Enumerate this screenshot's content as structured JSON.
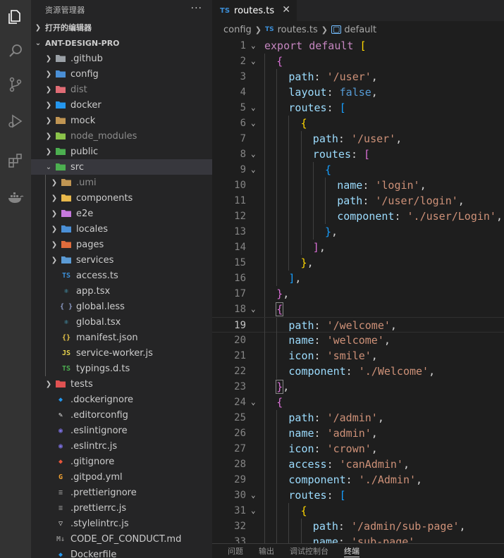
{
  "activity_bar": [
    {
      "name": "explorer-icon",
      "active": true
    },
    {
      "name": "search-icon",
      "active": false
    },
    {
      "name": "source-control-icon",
      "active": false
    },
    {
      "name": "run-debug-icon",
      "active": false
    },
    {
      "name": "extensions-icon",
      "active": false
    },
    {
      "name": "docker-icon",
      "active": false
    }
  ],
  "sidebar": {
    "title": "资源管理器",
    "more": "···",
    "open_editors": "打开的编辑器",
    "project": "ANT-DESIGN-PRO",
    "items": [
      {
        "label": ".github",
        "kind": "folder",
        "depth": 0,
        "icon": "github-folder-icon",
        "color": "#9aa0a6",
        "glyph": "◉"
      },
      {
        "label": "config",
        "kind": "folder",
        "depth": 0,
        "icon": "config-folder-icon",
        "color": "#4a8fd6",
        "glyph": "⚙"
      },
      {
        "label": "dist",
        "kind": "folder",
        "depth": 0,
        "icon": "dist-folder-icon",
        "color": "#e06c75",
        "glyph": "▪",
        "dim": true
      },
      {
        "label": "docker",
        "kind": "folder",
        "depth": 0,
        "icon": "docker-folder-icon",
        "color": "#2496ed",
        "glyph": "▪"
      },
      {
        "label": "mock",
        "kind": "folder",
        "depth": 0,
        "icon": "mock-folder-icon",
        "color": "#c09553",
        "glyph": "▪"
      },
      {
        "label": "node_modules",
        "kind": "folder",
        "depth": 0,
        "icon": "node-modules-folder-icon",
        "color": "#8bc34a",
        "glyph": "◆",
        "dim": true
      },
      {
        "label": "public",
        "kind": "folder",
        "depth": 0,
        "icon": "public-folder-icon",
        "color": "#4caf50",
        "glyph": "◆"
      },
      {
        "label": "src",
        "kind": "folder-open",
        "depth": 0,
        "icon": "src-folder-icon",
        "color": "#4caf50",
        "glyph": "◆",
        "selected": true
      },
      {
        "label": ".umi",
        "kind": "folder",
        "depth": 1,
        "icon": "umi-folder-icon",
        "color": "#c09553",
        "glyph": "▪",
        "dim": true
      },
      {
        "label": "components",
        "kind": "folder",
        "depth": 1,
        "icon": "components-folder-icon",
        "color": "#e8b84b",
        "glyph": "▪"
      },
      {
        "label": "e2e",
        "kind": "folder",
        "depth": 1,
        "icon": "e2e-folder-icon",
        "color": "#c678dd",
        "glyph": "▪"
      },
      {
        "label": "locales",
        "kind": "folder",
        "depth": 1,
        "icon": "locales-folder-icon",
        "color": "#4a8fd6",
        "glyph": "▪"
      },
      {
        "label": "pages",
        "kind": "folder",
        "depth": 1,
        "icon": "pages-folder-icon",
        "color": "#e06c3c",
        "glyph": "▪"
      },
      {
        "label": "services",
        "kind": "folder",
        "depth": 1,
        "icon": "services-folder-icon",
        "color": "#5b9bd5",
        "glyph": "▪"
      },
      {
        "label": "access.ts",
        "kind": "file",
        "depth": 1,
        "icon": "typescript-file-icon",
        "color": "#3c8fd8",
        "glyph": "TS"
      },
      {
        "label": "app.tsx",
        "kind": "file",
        "depth": 1,
        "icon": "react-file-icon",
        "color": "#4fb8d8",
        "glyph": "⚛"
      },
      {
        "label": "global.less",
        "kind": "file",
        "depth": 1,
        "icon": "less-file-icon",
        "color": "#8c9bc5",
        "glyph": "{ }"
      },
      {
        "label": "global.tsx",
        "kind": "file",
        "depth": 1,
        "icon": "react-file-icon",
        "color": "#4fb8d8",
        "glyph": "⚛"
      },
      {
        "label": "manifest.json",
        "kind": "file",
        "depth": 1,
        "icon": "json-file-icon",
        "color": "#e8c547",
        "glyph": "{}"
      },
      {
        "label": "service-worker.js",
        "kind": "file",
        "depth": 1,
        "icon": "javascript-file-icon",
        "color": "#e8d44d",
        "glyph": "JS"
      },
      {
        "label": "typings.d.ts",
        "kind": "file",
        "depth": 1,
        "icon": "typescript-def-file-icon",
        "color": "#4caf50",
        "glyph": "TS"
      },
      {
        "label": "tests",
        "kind": "folder",
        "depth": 0,
        "icon": "tests-folder-icon",
        "color": "#e05252",
        "glyph": "▪"
      },
      {
        "label": ".dockerignore",
        "kind": "file",
        "depth": 0,
        "icon": "docker-file-icon",
        "color": "#2496ed",
        "glyph": "◆"
      },
      {
        "label": ".editorconfig",
        "kind": "file",
        "depth": 0,
        "icon": "editorconfig-file-icon",
        "color": "#e0e0e0",
        "glyph": "✎"
      },
      {
        "label": ".eslintignore",
        "kind": "file",
        "depth": 0,
        "icon": "eslint-file-icon",
        "color": "#7b6fe0",
        "glyph": "◉"
      },
      {
        "label": ".eslintrc.js",
        "kind": "file",
        "depth": 0,
        "icon": "eslint-file-icon",
        "color": "#7b6fe0",
        "glyph": "◉"
      },
      {
        "label": ".gitignore",
        "kind": "file",
        "depth": 0,
        "icon": "git-file-icon",
        "color": "#e8563c",
        "glyph": "◆"
      },
      {
        "label": ".gitpod.yml",
        "kind": "file",
        "depth": 0,
        "icon": "gitpod-file-icon",
        "color": "#f0a030",
        "glyph": "G"
      },
      {
        "label": ".prettierignore",
        "kind": "file",
        "depth": 0,
        "icon": "prettier-file-icon",
        "color": "#8a8a8a",
        "glyph": "≡"
      },
      {
        "label": ".prettierrc.js",
        "kind": "file",
        "depth": 0,
        "icon": "prettier-file-icon",
        "color": "#8a8a8a",
        "glyph": "≡"
      },
      {
        "label": ".stylelintrc.js",
        "kind": "file",
        "depth": 0,
        "icon": "stylelint-file-icon",
        "color": "#e0e0e0",
        "glyph": "▽"
      },
      {
        "label": "CODE_OF_CONDUCT.md",
        "kind": "file",
        "depth": 0,
        "icon": "markdown-file-icon",
        "color": "#8a8a8a",
        "glyph": "M↓"
      },
      {
        "label": "Dockerfile",
        "kind": "file",
        "depth": 0,
        "icon": "docker-file-icon",
        "color": "#2496ed",
        "glyph": "◆"
      }
    ]
  },
  "tab": {
    "type": "TS",
    "title": "routes.ts",
    "close": "✕"
  },
  "breadcrumb": {
    "seg1": "config",
    "seg2": "routes.ts",
    "seg3": "default"
  },
  "editor": {
    "active_line": 19,
    "lines": [
      {
        "n": 1,
        "fold": "v",
        "indent": 0,
        "t": [
          [
            "export",
            "kw"
          ],
          [
            " ",
            "p"
          ],
          [
            "default",
            "kw"
          ],
          [
            " ",
            "p"
          ],
          [
            "[",
            "b1"
          ]
        ]
      },
      {
        "n": 2,
        "fold": "v",
        "indent": 1,
        "t": [
          [
            "{",
            "b2"
          ]
        ]
      },
      {
        "n": 3,
        "indent": 2,
        "t": [
          [
            "path",
            "prop"
          ],
          [
            ": ",
            "p"
          ],
          [
            "'/user'",
            "str"
          ],
          [
            ",",
            "p"
          ]
        ]
      },
      {
        "n": 4,
        "indent": 2,
        "t": [
          [
            "layout",
            "prop"
          ],
          [
            ": ",
            "p"
          ],
          [
            "false",
            "bool"
          ],
          [
            ",",
            "p"
          ]
        ]
      },
      {
        "n": 5,
        "fold": "v",
        "indent": 2,
        "t": [
          [
            "routes",
            "prop"
          ],
          [
            ": ",
            "p"
          ],
          [
            "[",
            "b3"
          ]
        ]
      },
      {
        "n": 6,
        "fold": "v",
        "indent": 3,
        "t": [
          [
            "{",
            "b1"
          ]
        ]
      },
      {
        "n": 7,
        "indent": 4,
        "t": [
          [
            "path",
            "prop"
          ],
          [
            ": ",
            "p"
          ],
          [
            "'/user'",
            "str"
          ],
          [
            ",",
            "p"
          ]
        ]
      },
      {
        "n": 8,
        "fold": "v",
        "indent": 4,
        "t": [
          [
            "routes",
            "prop"
          ],
          [
            ": ",
            "p"
          ],
          [
            "[",
            "b2"
          ]
        ]
      },
      {
        "n": 9,
        "fold": "v",
        "indent": 5,
        "t": [
          [
            "{",
            "b3"
          ]
        ]
      },
      {
        "n": 10,
        "indent": 6,
        "t": [
          [
            "name",
            "prop"
          ],
          [
            ": ",
            "p"
          ],
          [
            "'login'",
            "str"
          ],
          [
            ",",
            "p"
          ]
        ]
      },
      {
        "n": 11,
        "indent": 6,
        "t": [
          [
            "path",
            "prop"
          ],
          [
            ": ",
            "p"
          ],
          [
            "'/user/login'",
            "str"
          ],
          [
            ",",
            "p"
          ]
        ]
      },
      {
        "n": 12,
        "indent": 6,
        "t": [
          [
            "component",
            "prop"
          ],
          [
            ": ",
            "p"
          ],
          [
            "'./user/Login'",
            "str"
          ],
          [
            ",",
            "p"
          ]
        ]
      },
      {
        "n": 13,
        "indent": 5,
        "t": [
          [
            "}",
            "b3"
          ],
          [
            ",",
            "p"
          ]
        ]
      },
      {
        "n": 14,
        "indent": 4,
        "t": [
          [
            "]",
            "b2"
          ],
          [
            ",",
            "p"
          ]
        ]
      },
      {
        "n": 15,
        "indent": 3,
        "t": [
          [
            "}",
            "b1"
          ],
          [
            ",",
            "p"
          ]
        ]
      },
      {
        "n": 16,
        "indent": 2,
        "t": [
          [
            "]",
            "b3"
          ],
          [
            ",",
            "p"
          ]
        ]
      },
      {
        "n": 17,
        "indent": 1,
        "t": [
          [
            "}",
            "b2"
          ],
          [
            ",",
            "p"
          ]
        ]
      },
      {
        "n": 18,
        "fold": "v",
        "indent": 1,
        "t": [
          [
            "{",
            "b2"
          ]
        ],
        "boxed": true
      },
      {
        "n": 19,
        "indent": 2,
        "t": [
          [
            "path",
            "prop"
          ],
          [
            ": ",
            "p"
          ],
          [
            "'/welcome'",
            "str"
          ],
          [
            ",",
            "p"
          ]
        ]
      },
      {
        "n": 20,
        "indent": 2,
        "t": [
          [
            "name",
            "prop"
          ],
          [
            ": ",
            "p"
          ],
          [
            "'welcome'",
            "str"
          ],
          [
            ",",
            "p"
          ]
        ]
      },
      {
        "n": 21,
        "indent": 2,
        "t": [
          [
            "icon",
            "prop"
          ],
          [
            ": ",
            "p"
          ],
          [
            "'smile'",
            "str"
          ],
          [
            ",",
            "p"
          ]
        ]
      },
      {
        "n": 22,
        "indent": 2,
        "t": [
          [
            "component",
            "prop"
          ],
          [
            ": ",
            "p"
          ],
          [
            "'./Welcome'",
            "str"
          ],
          [
            ",",
            "p"
          ]
        ]
      },
      {
        "n": 23,
        "indent": 1,
        "t": [
          [
            "}",
            "b2"
          ],
          [
            ",",
            "p"
          ]
        ],
        "boxed": true
      },
      {
        "n": 24,
        "fold": "v",
        "indent": 1,
        "t": [
          [
            "{",
            "b2"
          ]
        ]
      },
      {
        "n": 25,
        "indent": 2,
        "t": [
          [
            "path",
            "prop"
          ],
          [
            ": ",
            "p"
          ],
          [
            "'/admin'",
            "str"
          ],
          [
            ",",
            "p"
          ]
        ]
      },
      {
        "n": 26,
        "indent": 2,
        "t": [
          [
            "name",
            "prop"
          ],
          [
            ": ",
            "p"
          ],
          [
            "'admin'",
            "str"
          ],
          [
            ",",
            "p"
          ]
        ]
      },
      {
        "n": 27,
        "indent": 2,
        "t": [
          [
            "icon",
            "prop"
          ],
          [
            ": ",
            "p"
          ],
          [
            "'crown'",
            "str"
          ],
          [
            ",",
            "p"
          ]
        ]
      },
      {
        "n": 28,
        "indent": 2,
        "t": [
          [
            "access",
            "prop"
          ],
          [
            ": ",
            "p"
          ],
          [
            "'canAdmin'",
            "str"
          ],
          [
            ",",
            "p"
          ]
        ]
      },
      {
        "n": 29,
        "indent": 2,
        "t": [
          [
            "component",
            "prop"
          ],
          [
            ": ",
            "p"
          ],
          [
            "'./Admin'",
            "str"
          ],
          [
            ",",
            "p"
          ]
        ]
      },
      {
        "n": 30,
        "fold": "v",
        "indent": 2,
        "t": [
          [
            "routes",
            "prop"
          ],
          [
            ": ",
            "p"
          ],
          [
            "[",
            "b3"
          ]
        ]
      },
      {
        "n": 31,
        "fold": "v",
        "indent": 3,
        "t": [
          [
            "{",
            "b1"
          ]
        ]
      },
      {
        "n": 32,
        "indent": 4,
        "t": [
          [
            "path",
            "prop"
          ],
          [
            ": ",
            "p"
          ],
          [
            "'/admin/sub-page'",
            "str"
          ],
          [
            ",",
            "p"
          ]
        ]
      },
      {
        "n": 33,
        "indent": 4,
        "t": [
          [
            "name",
            "prop"
          ],
          [
            ": ",
            "p"
          ],
          [
            "'sub-page'",
            "str"
          ],
          [
            ",",
            "p"
          ]
        ]
      }
    ]
  },
  "panel": {
    "tabs": [
      "问题",
      "输出",
      "调试控制台",
      "终端"
    ],
    "active": 3
  },
  "colors": {
    "kw": "#c586c0",
    "prop": "#9cdcfe",
    "str": "#ce9178",
    "bool": "#569cd6",
    "p": "#d4d4d4",
    "b1": "#ffd700",
    "b2": "#da70d6",
    "b3": "#179fff"
  }
}
